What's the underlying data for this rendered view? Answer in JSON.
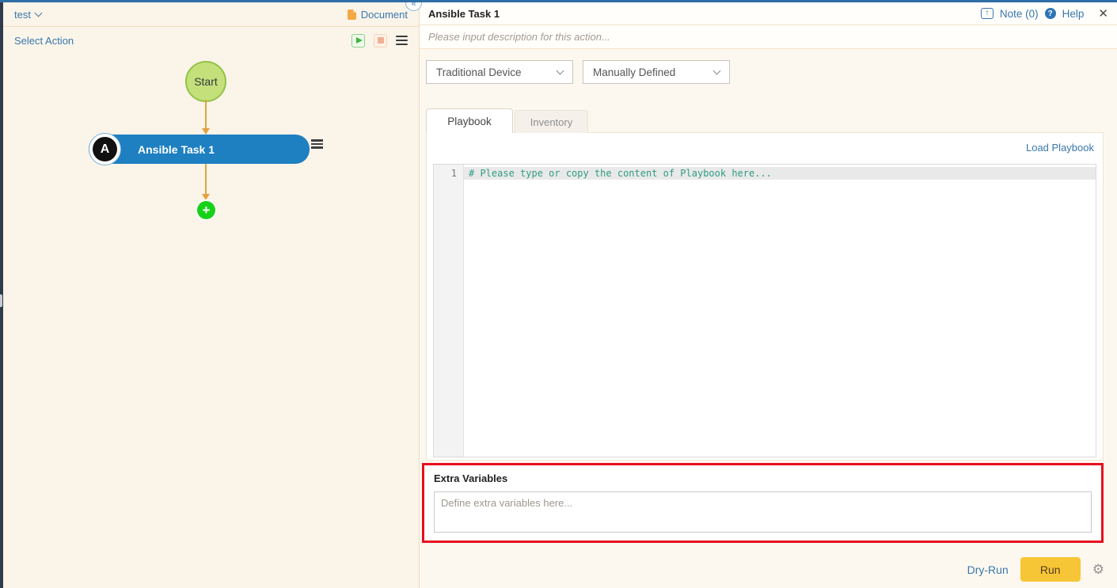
{
  "colors": {
    "top_border_blue": "#2f6ea6",
    "link_blue": "#3a77ad",
    "task_node_blue": "#1e7fc1",
    "start_node_green": "#c4e07b",
    "connector_orange": "#e3a23f",
    "add_button_green": "#17d117",
    "run_button_yellow": "#f7c637",
    "highlight_red": "#e70f1f",
    "editor_comment_teal": "#2f9c82"
  },
  "left_panel": {
    "workflow_name": "test",
    "document_label": "Document",
    "select_action_label": "Select Action",
    "flow": {
      "start_node_label": "Start",
      "task_node_label": "Ansible Task 1",
      "task_logo_letter": "A",
      "add_node_glyph": "+"
    }
  },
  "divider": {
    "collapse_glyph": "«"
  },
  "right_panel": {
    "title": "Ansible Task 1",
    "note_label": "Note (0)",
    "help_label": "Help",
    "help_glyph": "?",
    "popout_glyph": "↑",
    "close_glyph": "✕",
    "description_placeholder": "Please input description for this action...",
    "device_type_selected": "Traditional Device",
    "inventory_source_selected": "Manually Defined",
    "tabs": [
      {
        "label": "Playbook",
        "active": true
      },
      {
        "label": "Inventory",
        "active": false
      }
    ],
    "load_playbook_label": "Load Playbook",
    "editor": {
      "line_number": "1",
      "placeholder_comment": "# Please type or copy the content of Playbook here..."
    },
    "extra_variables": {
      "label": "Extra Variables",
      "placeholder": "Define extra variables here..."
    },
    "footer": {
      "dry_run_label": "Dry-Run",
      "run_label": "Run",
      "gear_glyph": "⚙"
    }
  }
}
